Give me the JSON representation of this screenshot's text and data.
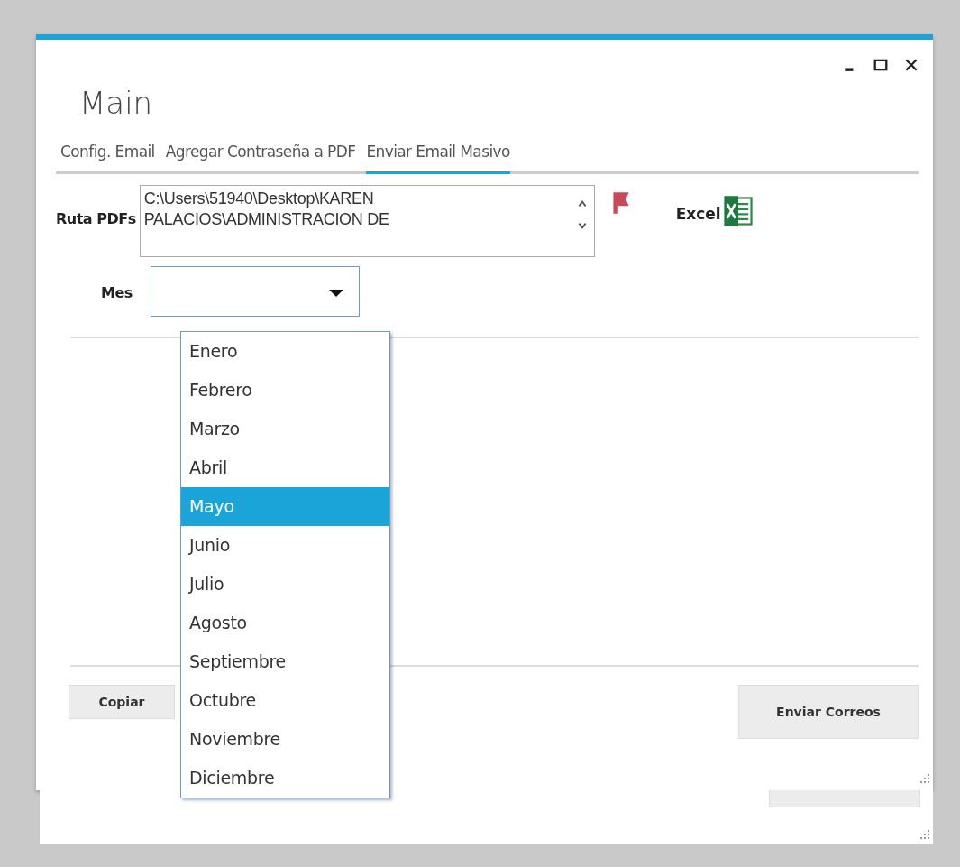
{
  "window": {
    "title": "Main"
  },
  "tabs": [
    {
      "label": "Config. Email",
      "selected": false
    },
    {
      "label": "Agregar Contraseña a PDF",
      "selected": false
    },
    {
      "label": "Enviar Email Masivo",
      "selected": true
    }
  ],
  "ruta_pdfs": {
    "label": "Ruta PDFs",
    "value": "C:\\Users\\51940\\Desktop\\KAREN PALACIOS\\ADMINISTRACION DE"
  },
  "excel": {
    "label": "Excel"
  },
  "mes": {
    "label": "Mes",
    "expanded": true,
    "options": [
      {
        "label": "Enero",
        "selected": false
      },
      {
        "label": "Febrero",
        "selected": false
      },
      {
        "label": "Marzo",
        "selected": false
      },
      {
        "label": "Abril",
        "selected": false
      },
      {
        "label": "Mayo",
        "selected": true
      },
      {
        "label": "Junio",
        "selected": false
      },
      {
        "label": "Julio",
        "selected": false
      },
      {
        "label": "Agosto",
        "selected": false
      },
      {
        "label": "Septiembre",
        "selected": false
      },
      {
        "label": "Octubre",
        "selected": false
      },
      {
        "label": "Noviembre",
        "selected": false
      },
      {
        "label": "Diciembre",
        "selected": false
      }
    ]
  },
  "buttons": {
    "copy": "Copiar",
    "send": "Enviar Correos"
  }
}
